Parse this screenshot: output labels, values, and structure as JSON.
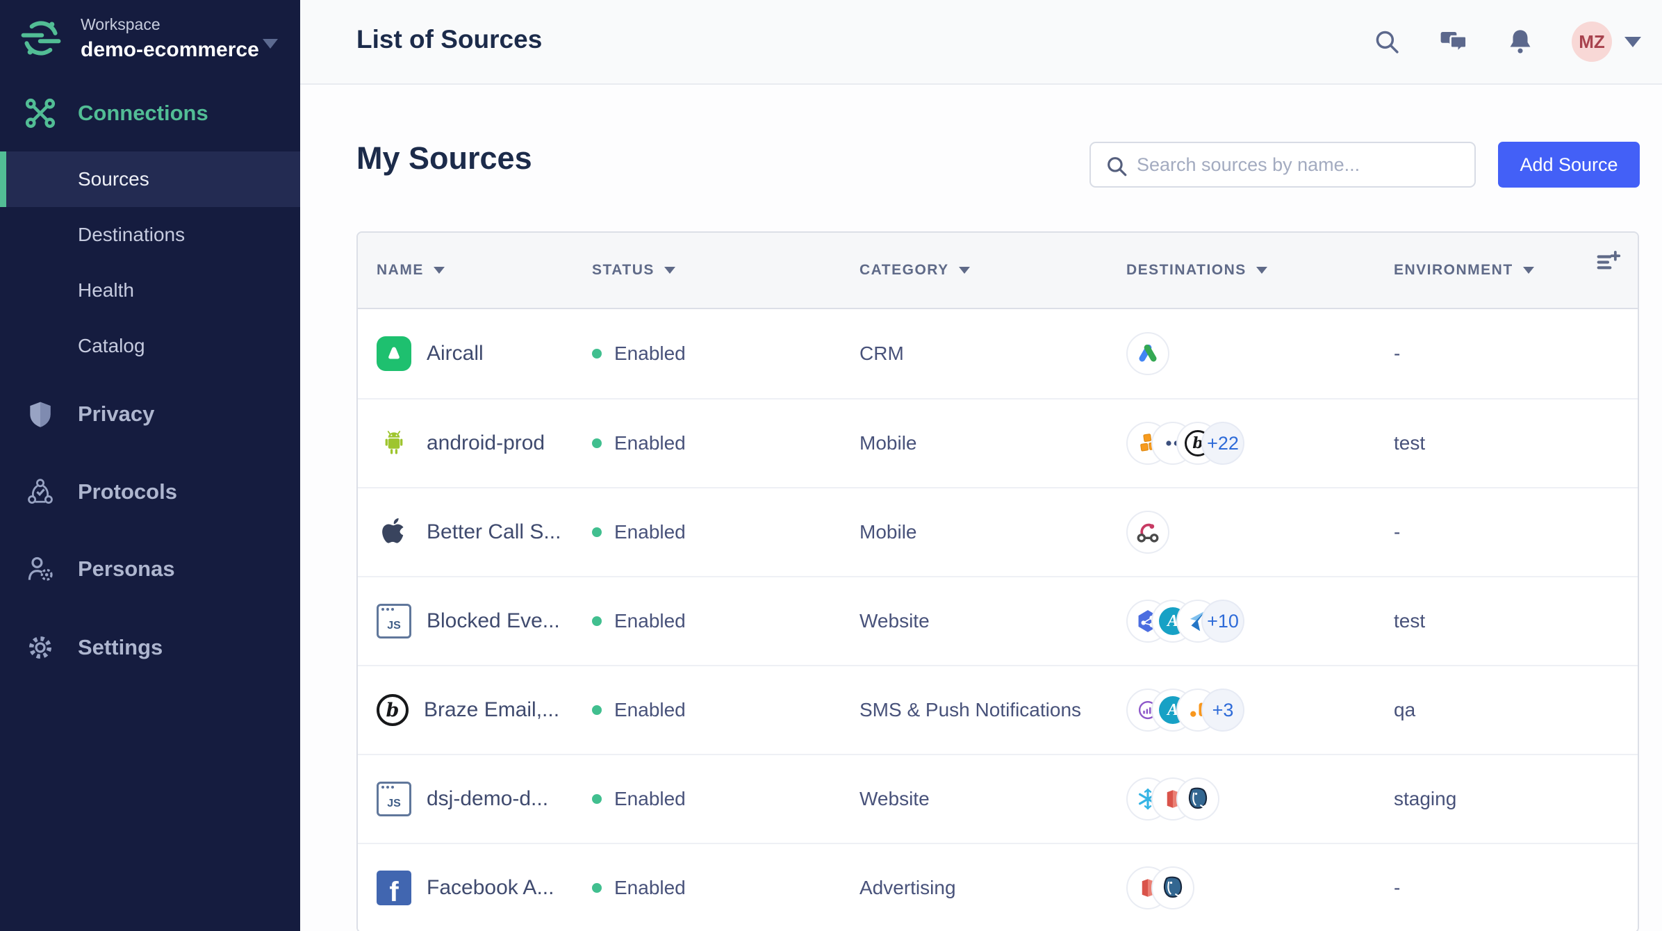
{
  "sidebar": {
    "workspace": {
      "label": "Workspace",
      "name": "demo-ecommerce"
    },
    "connections_label": "Connections",
    "connection_items": [
      {
        "label": "Sources",
        "active": true
      },
      {
        "label": "Destinations",
        "active": false
      },
      {
        "label": "Health",
        "active": false
      },
      {
        "label": "Catalog",
        "active": false
      }
    ],
    "sections": [
      {
        "icon": "shield-icon",
        "label": "Privacy"
      },
      {
        "icon": "protocols-icon",
        "label": "Protocols"
      },
      {
        "icon": "personas-icon",
        "label": "Personas"
      },
      {
        "icon": "gear-icon",
        "label": "Settings"
      }
    ]
  },
  "topbar": {
    "title": "List of Sources",
    "avatar_initials": "MZ"
  },
  "main": {
    "heading": "My Sources",
    "search_placeholder": "Search sources by name...",
    "add_source_label": "Add Source"
  },
  "table": {
    "columns": [
      "NAME",
      "STATUS",
      "CATEGORY",
      "DESTINATIONS",
      "ENVIRONMENT"
    ],
    "rows": [
      {
        "name": "Aircall",
        "icon": "aircall",
        "status": "Enabled",
        "category": "CRM",
        "destinations": {
          "icons": [
            "google-ads"
          ],
          "more": ""
        },
        "environment": "-"
      },
      {
        "name": "android-prod",
        "icon": "android",
        "status": "Enabled",
        "category": "Mobile",
        "destinations": {
          "icons": [
            "aws",
            "dots",
            "braze"
          ],
          "more": "+22"
        },
        "environment": "test"
      },
      {
        "name": "Better Call S...",
        "icon": "apple",
        "status": "Enabled",
        "category": "Mobile",
        "destinations": {
          "icons": [
            "webhook"
          ],
          "more": ""
        },
        "environment": "-"
      },
      {
        "name": "Blocked Eve...",
        "icon": "javascript",
        "status": "Enabled",
        "category": "Website",
        "destinations": {
          "icons": [
            "hexagon-network",
            "amplitude",
            "paper-plane"
          ],
          "more": "+10"
        },
        "environment": "test"
      },
      {
        "name": "Braze Email,...",
        "icon": "braze",
        "status": "Enabled",
        "category": "SMS & Push Notifications",
        "destinations": {
          "icons": [
            "purple-chart",
            "amplitude",
            "analytics-orange"
          ],
          "more": "+3"
        },
        "environment": "qa"
      },
      {
        "name": "dsj-demo-d...",
        "icon": "javascript",
        "status": "Enabled",
        "category": "Website",
        "destinations": {
          "icons": [
            "snowflake",
            "redshift",
            "postgres"
          ],
          "more": ""
        },
        "environment": "staging"
      },
      {
        "name": "Facebook A...",
        "icon": "facebook",
        "status": "Enabled",
        "category": "Advertising",
        "destinations": {
          "icons": [
            "redshift",
            "postgres"
          ],
          "more": ""
        },
        "environment": "-"
      }
    ]
  },
  "colors": {
    "accent_green": "#52bd95",
    "sidebar_bg": "#151c3f",
    "primary_button_blue": "#4360f7",
    "status_enabled_green": "#41bf8f",
    "badge_text_blue": "#2e6bd8"
  }
}
